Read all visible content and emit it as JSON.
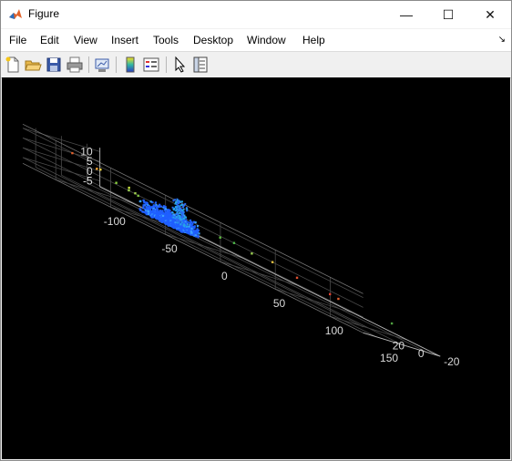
{
  "window": {
    "title": "Figure",
    "minimize": "—",
    "maximize": "☐",
    "close": "✕"
  },
  "menu": {
    "items": [
      "File",
      "Edit",
      "View",
      "Insert",
      "Tools",
      "Desktop",
      "Window",
      "Help"
    ],
    "dock_arrow": "↘"
  },
  "toolbar": {
    "icons": [
      "new-figure-icon",
      "open-file-icon",
      "save-icon",
      "print-icon",
      "link-plot-icon",
      "insert-colorbar-icon",
      "insert-legend-icon",
      "edit-plot-arrow-icon",
      "property-inspector-icon"
    ]
  },
  "colors": {
    "figure_background": "#000000",
    "grid": "#4a4a4a",
    "tick_text": "#d9d9d9",
    "point_cluster": "#1f5fff"
  },
  "chart_data": {
    "type": "scatter",
    "projection": "3d",
    "x_ticks": [
      "-100",
      "-50",
      "0",
      "50",
      "100",
      "150"
    ],
    "y_ticks": [
      "-20",
      "0",
      "20"
    ],
    "z_ticks": [
      "-5",
      "0",
      "5",
      "10"
    ],
    "xlim": [
      -130,
      180
    ],
    "ylim": [
      -30,
      30
    ],
    "zlim": [
      -8,
      12
    ],
    "grid": true,
    "colormap": "parula-like, colored by height",
    "points_note": "dense point cloud cluster near x≈-40..-10, y≈0..10 with sparse colored points scattered along the x axis"
  }
}
